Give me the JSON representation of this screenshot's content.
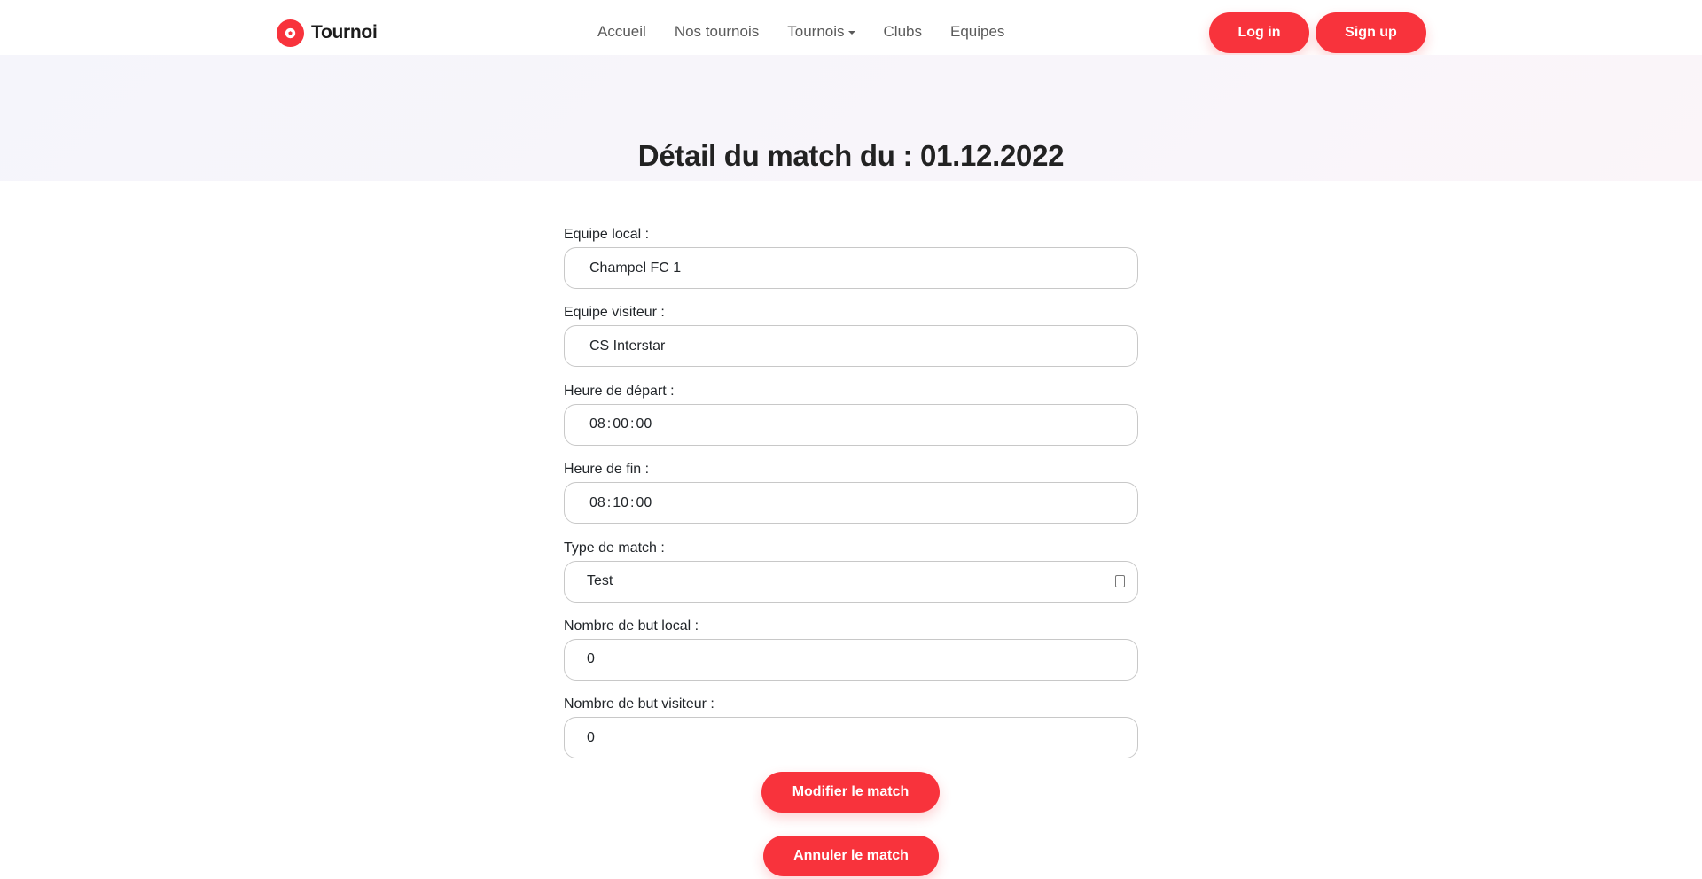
{
  "nav": {
    "brand": "Tournoi",
    "links": [
      {
        "label": "Accueil"
      },
      {
        "label": "Nos tournois"
      },
      {
        "label": "Tournois",
        "has_dropdown": true
      },
      {
        "label": "Clubs"
      },
      {
        "label": "Equipes"
      }
    ],
    "login_label": "Log in",
    "signup_label": "Sign up"
  },
  "page": {
    "title": "Détail du match du : 01.12.2022"
  },
  "form": {
    "home_team": {
      "label": "Equipe local :",
      "value": "Champel FC 1"
    },
    "away_team": {
      "label": "Equipe visiteur :",
      "value": "CS Interstar"
    },
    "start_time": {
      "label": "Heure de départ :",
      "hours": "08",
      "minutes": "00",
      "seconds": "00"
    },
    "end_time": {
      "label": "Heure de fin :",
      "hours": "08",
      "minutes": "10",
      "seconds": "00"
    },
    "match_type": {
      "label": "Type de match :",
      "value": "Test"
    },
    "home_goals": {
      "label": "Nombre de but local :",
      "value": "0"
    },
    "away_goals": {
      "label": "Nombre de but visiteur :",
      "value": "0"
    },
    "modify_label": "Modifier le match",
    "cancel_label": "Annuler le match"
  },
  "colors": {
    "accent": "#f8333c",
    "hero_bg": "#f6f5fa"
  }
}
